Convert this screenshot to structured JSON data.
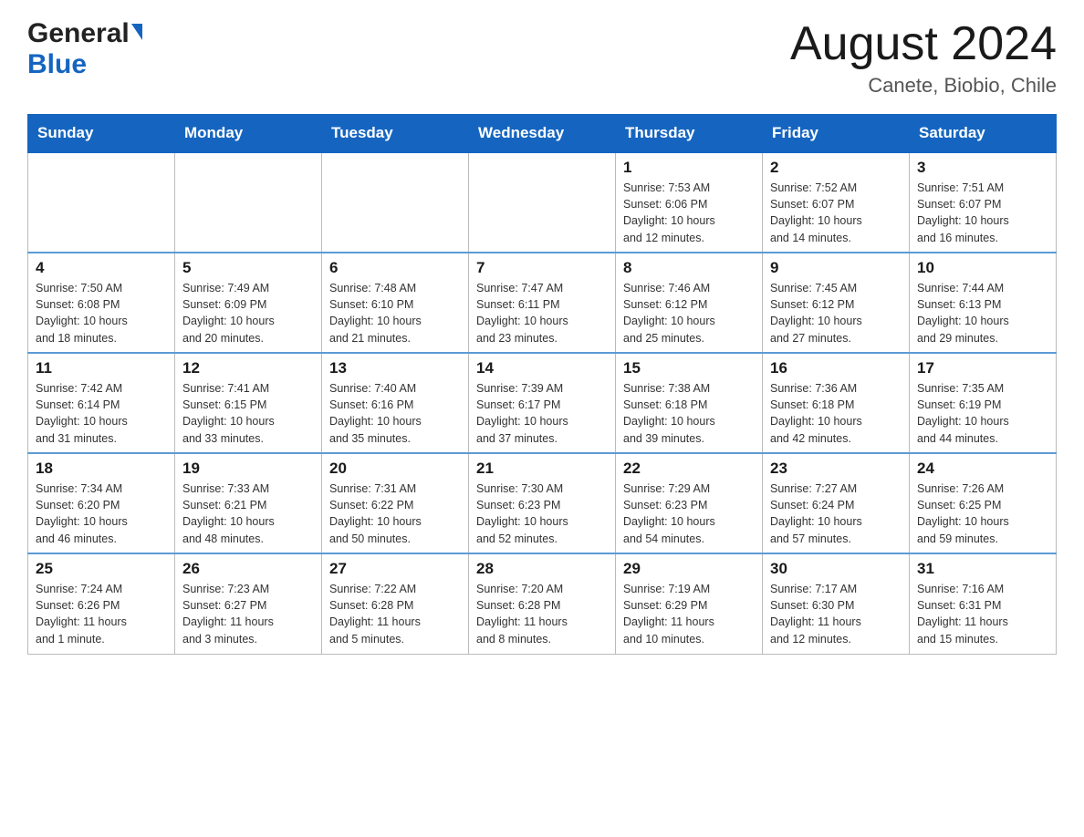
{
  "header": {
    "logo_general": "General",
    "logo_blue": "Blue",
    "title": "August 2024",
    "subtitle": "Canete, Biobio, Chile"
  },
  "weekdays": [
    "Sunday",
    "Monday",
    "Tuesday",
    "Wednesday",
    "Thursday",
    "Friday",
    "Saturday"
  ],
  "weeks": [
    {
      "days": [
        {
          "num": "",
          "info": ""
        },
        {
          "num": "",
          "info": ""
        },
        {
          "num": "",
          "info": ""
        },
        {
          "num": "",
          "info": ""
        },
        {
          "num": "1",
          "info": "Sunrise: 7:53 AM\nSunset: 6:06 PM\nDaylight: 10 hours\nand 12 minutes."
        },
        {
          "num": "2",
          "info": "Sunrise: 7:52 AM\nSunset: 6:07 PM\nDaylight: 10 hours\nand 14 minutes."
        },
        {
          "num": "3",
          "info": "Sunrise: 7:51 AM\nSunset: 6:07 PM\nDaylight: 10 hours\nand 16 minutes."
        }
      ]
    },
    {
      "days": [
        {
          "num": "4",
          "info": "Sunrise: 7:50 AM\nSunset: 6:08 PM\nDaylight: 10 hours\nand 18 minutes."
        },
        {
          "num": "5",
          "info": "Sunrise: 7:49 AM\nSunset: 6:09 PM\nDaylight: 10 hours\nand 20 minutes."
        },
        {
          "num": "6",
          "info": "Sunrise: 7:48 AM\nSunset: 6:10 PM\nDaylight: 10 hours\nand 21 minutes."
        },
        {
          "num": "7",
          "info": "Sunrise: 7:47 AM\nSunset: 6:11 PM\nDaylight: 10 hours\nand 23 minutes."
        },
        {
          "num": "8",
          "info": "Sunrise: 7:46 AM\nSunset: 6:12 PM\nDaylight: 10 hours\nand 25 minutes."
        },
        {
          "num": "9",
          "info": "Sunrise: 7:45 AM\nSunset: 6:12 PM\nDaylight: 10 hours\nand 27 minutes."
        },
        {
          "num": "10",
          "info": "Sunrise: 7:44 AM\nSunset: 6:13 PM\nDaylight: 10 hours\nand 29 minutes."
        }
      ]
    },
    {
      "days": [
        {
          "num": "11",
          "info": "Sunrise: 7:42 AM\nSunset: 6:14 PM\nDaylight: 10 hours\nand 31 minutes."
        },
        {
          "num": "12",
          "info": "Sunrise: 7:41 AM\nSunset: 6:15 PM\nDaylight: 10 hours\nand 33 minutes."
        },
        {
          "num": "13",
          "info": "Sunrise: 7:40 AM\nSunset: 6:16 PM\nDaylight: 10 hours\nand 35 minutes."
        },
        {
          "num": "14",
          "info": "Sunrise: 7:39 AM\nSunset: 6:17 PM\nDaylight: 10 hours\nand 37 minutes."
        },
        {
          "num": "15",
          "info": "Sunrise: 7:38 AM\nSunset: 6:18 PM\nDaylight: 10 hours\nand 39 minutes."
        },
        {
          "num": "16",
          "info": "Sunrise: 7:36 AM\nSunset: 6:18 PM\nDaylight: 10 hours\nand 42 minutes."
        },
        {
          "num": "17",
          "info": "Sunrise: 7:35 AM\nSunset: 6:19 PM\nDaylight: 10 hours\nand 44 minutes."
        }
      ]
    },
    {
      "days": [
        {
          "num": "18",
          "info": "Sunrise: 7:34 AM\nSunset: 6:20 PM\nDaylight: 10 hours\nand 46 minutes."
        },
        {
          "num": "19",
          "info": "Sunrise: 7:33 AM\nSunset: 6:21 PM\nDaylight: 10 hours\nand 48 minutes."
        },
        {
          "num": "20",
          "info": "Sunrise: 7:31 AM\nSunset: 6:22 PM\nDaylight: 10 hours\nand 50 minutes."
        },
        {
          "num": "21",
          "info": "Sunrise: 7:30 AM\nSunset: 6:23 PM\nDaylight: 10 hours\nand 52 minutes."
        },
        {
          "num": "22",
          "info": "Sunrise: 7:29 AM\nSunset: 6:23 PM\nDaylight: 10 hours\nand 54 minutes."
        },
        {
          "num": "23",
          "info": "Sunrise: 7:27 AM\nSunset: 6:24 PM\nDaylight: 10 hours\nand 57 minutes."
        },
        {
          "num": "24",
          "info": "Sunrise: 7:26 AM\nSunset: 6:25 PM\nDaylight: 10 hours\nand 59 minutes."
        }
      ]
    },
    {
      "days": [
        {
          "num": "25",
          "info": "Sunrise: 7:24 AM\nSunset: 6:26 PM\nDaylight: 11 hours\nand 1 minute."
        },
        {
          "num": "26",
          "info": "Sunrise: 7:23 AM\nSunset: 6:27 PM\nDaylight: 11 hours\nand 3 minutes."
        },
        {
          "num": "27",
          "info": "Sunrise: 7:22 AM\nSunset: 6:28 PM\nDaylight: 11 hours\nand 5 minutes."
        },
        {
          "num": "28",
          "info": "Sunrise: 7:20 AM\nSunset: 6:28 PM\nDaylight: 11 hours\nand 8 minutes."
        },
        {
          "num": "29",
          "info": "Sunrise: 7:19 AM\nSunset: 6:29 PM\nDaylight: 11 hours\nand 10 minutes."
        },
        {
          "num": "30",
          "info": "Sunrise: 7:17 AM\nSunset: 6:30 PM\nDaylight: 11 hours\nand 12 minutes."
        },
        {
          "num": "31",
          "info": "Sunrise: 7:16 AM\nSunset: 6:31 PM\nDaylight: 11 hours\nand 15 minutes."
        }
      ]
    }
  ]
}
